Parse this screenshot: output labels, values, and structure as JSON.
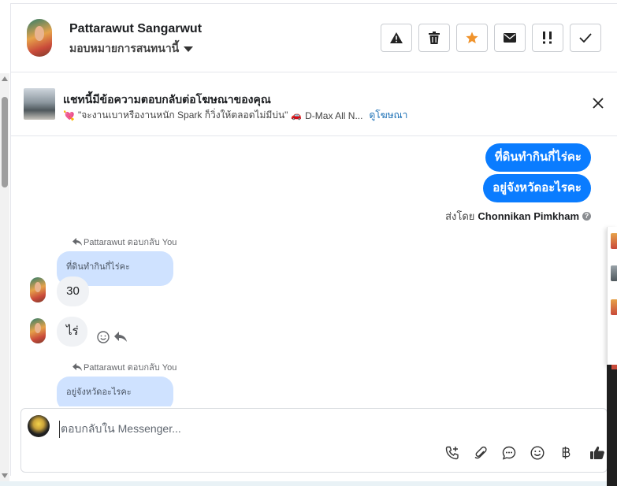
{
  "header": {
    "contact_name": "Pattarawut Sangarwut",
    "assign_label": "มอบหมายการสนทนานี้",
    "actions": [
      {
        "name": "report-spam-button",
        "icon": "warning-icon"
      },
      {
        "name": "delete-button",
        "icon": "trash-icon"
      },
      {
        "name": "star-button",
        "icon": "star-icon"
      },
      {
        "name": "mark-unread-button",
        "icon": "envelope-icon"
      },
      {
        "name": "mark-followup-button",
        "icon": "followup-icon"
      },
      {
        "name": "mark-done-button",
        "icon": "check-icon"
      }
    ]
  },
  "banner": {
    "title": "แชทนี้มีข้อความตอบกลับต่อโฆษณาของคุณ",
    "subtitle": "\"จะงานเบาหรืองานหนัก Spark ก็วิ่งให้ตลอดไม่มีบ่น\"",
    "subtitle_tail": "D-Max All N...",
    "link": "ดูโฆษณา"
  },
  "chat": {
    "outgoing": [
      "ที่ดินทำกินกี่ไร่คะ",
      "อยู่จังหวัดอะไรคะ"
    ],
    "sent_by_prefix": "ส่งโดย",
    "sent_by_name": "Chonnikan Pimkham",
    "replies": [
      {
        "note": "Pattarawut ตอบกลับ You",
        "quote": "ที่ดินทำกินกี่ไร่คะ",
        "messages": [
          "30",
          "ไร่"
        ]
      },
      {
        "note": "Pattarawut ตอบกลับ You",
        "quote": "อยู่จังหวัดอะไรคะ",
        "messages": []
      }
    ]
  },
  "composer": {
    "placeholder": "ตอบกลับใน Messenger...",
    "tools": [
      "call-add-icon",
      "paperclip-icon",
      "quick-reply-icon",
      "emoji-icon",
      "baht-icon",
      "thumbs-up-icon"
    ]
  },
  "colors": {
    "outgoing_bubble": "#0a7cff",
    "quote_bubble": "#cfe2ff",
    "incoming_bubble": "#f0f2f5",
    "star": "#f0932b",
    "link": "#1a6fb5"
  }
}
